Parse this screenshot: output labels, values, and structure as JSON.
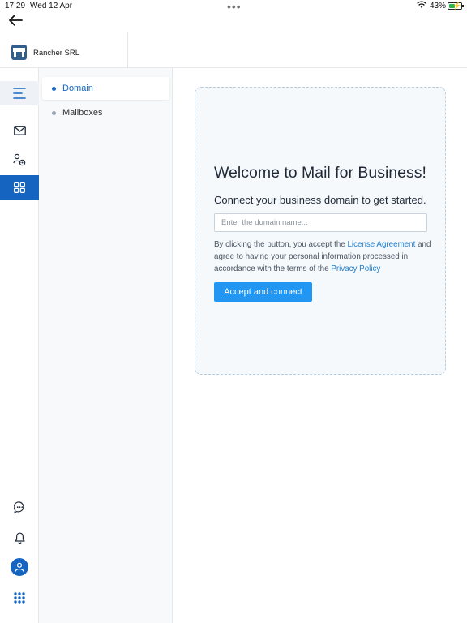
{
  "status_bar": {
    "time": "17:29",
    "date": "Wed 12 Apr",
    "battery_percent": "43%",
    "battery_level": 0.43,
    "icons": [
      "more-dots-icon",
      "wifi-icon",
      "battery-charging-icon"
    ]
  },
  "navigation": {
    "back_icon": "back-arrow-icon"
  },
  "header": {
    "org_name": "Rancher SRL",
    "org_logo_icon": "organization-logo-icon"
  },
  "rail": {
    "top_items": [
      {
        "name": "menu",
        "icon": "hamburger-menu-icon",
        "active": false,
        "highlighted": true
      },
      {
        "name": "mail",
        "icon": "mail-envelope-icon",
        "active": false
      },
      {
        "name": "users-settings",
        "icon": "users-settings-icon",
        "active": false
      },
      {
        "name": "apps",
        "icon": "apps-grid-icon",
        "active": true
      }
    ],
    "bottom_items": [
      {
        "name": "chat",
        "icon": "chat-bubble-icon"
      },
      {
        "name": "notifications",
        "icon": "bell-icon"
      },
      {
        "name": "profile",
        "icon": "user-avatar-icon"
      },
      {
        "name": "app-launcher",
        "icon": "dots-grid-icon"
      }
    ]
  },
  "subnav": {
    "items": [
      {
        "label": "Domain",
        "active": true
      },
      {
        "label": "Mailboxes",
        "active": false
      }
    ]
  },
  "welcome": {
    "title": "Welcome to Mail for Business!",
    "subtitle": "Connect your business domain to get started.",
    "domain_input": {
      "value": "",
      "placeholder": "Enter the domain name..."
    },
    "consent_prefix": "By clicking the button, you accept the",
    "license_link": "License Agreement",
    "consent_middle": "and agree to having your personal information processed in accordance with the terms of the",
    "privacy_link": "Privacy Policy",
    "button_label": "Accept and connect"
  },
  "colors": {
    "accent": "#1565c0",
    "button": "#2196f3",
    "link": "#1e7fd0",
    "card_background": "#f6f9fc",
    "card_border": "#b9cde0"
  }
}
